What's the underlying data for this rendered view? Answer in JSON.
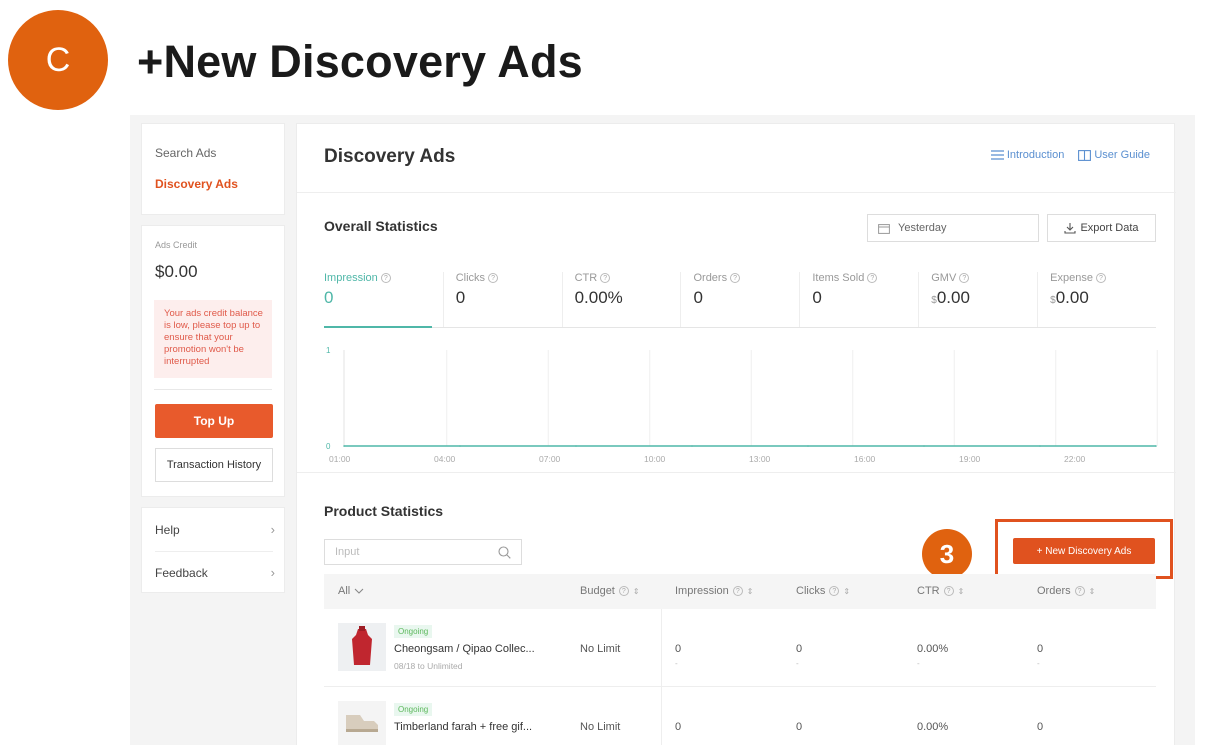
{
  "header": {
    "step_letter": "C",
    "title": "+New Discovery Ads"
  },
  "sidebar": {
    "items": [
      {
        "label": "Search Ads",
        "active": false
      },
      {
        "label": "Discovery Ads",
        "active": true
      }
    ]
  },
  "credit": {
    "label": "Ads Credit",
    "value": "$0.00",
    "warning": "Your ads credit balance is low, please top up to ensure that your promotion won't be interrupted",
    "topup_label": "Top Up",
    "history_label": "Transaction History"
  },
  "help_links": [
    {
      "label": "Help"
    },
    {
      "label": "Feedback"
    }
  ],
  "panel": {
    "title": "Discovery Ads",
    "introduction_label": "Introduction",
    "user_guide_label": "User Guide"
  },
  "overall": {
    "title": "Overall Statistics",
    "date_value": "Yesterday",
    "export_label": "Export Data",
    "metrics": [
      {
        "label": "Impression",
        "value": "0",
        "currency": ""
      },
      {
        "label": "Clicks",
        "value": "0",
        "currency": ""
      },
      {
        "label": "CTR",
        "value": "0.00%",
        "currency": ""
      },
      {
        "label": "Orders",
        "value": "0",
        "currency": ""
      },
      {
        "label": "Items Sold",
        "value": "0",
        "currency": ""
      },
      {
        "label": "GMV",
        "value": "0.00",
        "currency": "$"
      },
      {
        "label": "Expense",
        "value": "0.00",
        "currency": "$"
      }
    ]
  },
  "chart_data": {
    "type": "line",
    "x": [
      "01:00",
      "04:00",
      "07:00",
      "10:00",
      "13:00",
      "16:00",
      "19:00",
      "22:00"
    ],
    "series": [
      {
        "values": [
          0,
          0,
          0,
          0,
          0,
          0,
          0,
          0
        ],
        "color": "#4fb7a8"
      }
    ],
    "y_ticks": [
      "1",
      "0"
    ],
    "ylim": [
      0,
      1
    ],
    "grid": true
  },
  "product": {
    "title": "Product Statistics",
    "search_placeholder": "Input",
    "step_number": "3",
    "new_button_label": "+ New Discovery Ads",
    "columns": [
      "All",
      "Budget",
      "Impression",
      "Clicks",
      "CTR",
      "Orders"
    ],
    "rows": [
      {
        "status": "Ongoing",
        "name": "Cheongsam / Qipao Collec...",
        "date": "08/18 to Unlimited",
        "budget": "No Limit",
        "impression": "0",
        "clicks": "0",
        "ctr": "0.00%",
        "orders": "0"
      },
      {
        "status": "Ongoing",
        "name": "Timberland farah + free gif...",
        "date": "",
        "budget": "No Limit",
        "impression": "0",
        "clicks": "0",
        "ctr": "0.00%",
        "orders": "0"
      }
    ]
  },
  "colors": {
    "accent": "#e0521f",
    "teal": "#4fb7a8",
    "link": "#5a8fd0"
  }
}
